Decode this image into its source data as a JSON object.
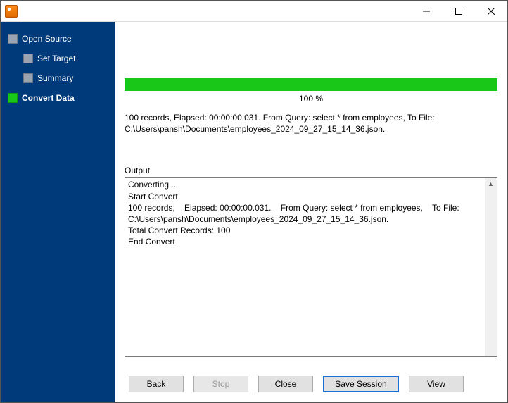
{
  "window": {
    "title": ""
  },
  "nav": {
    "open_source": "Open Source",
    "set_target": "Set Target",
    "summary": "Summary",
    "convert_data": "Convert Data"
  },
  "progress": {
    "percent_text": "100 %",
    "percent_value": 100
  },
  "summary_text": "100 records,    Elapsed: 00:00:00.031.    From Query: select * from employees,    To File: C:\\Users\\pansh\\Documents\\employees_2024_09_27_15_14_36.json.",
  "output": {
    "label": "Output",
    "text": "Converting...\nStart Convert\n100 records,    Elapsed: 00:00:00.031.    From Query: select * from employees,    To File: C:\\Users\\pansh\\Documents\\employees_2024_09_27_15_14_36.json.\nTotal Convert Records: 100\nEnd Convert"
  },
  "buttons": {
    "back": "Back",
    "stop": "Stop",
    "close": "Close",
    "save_session": "Save Session",
    "view": "View"
  }
}
